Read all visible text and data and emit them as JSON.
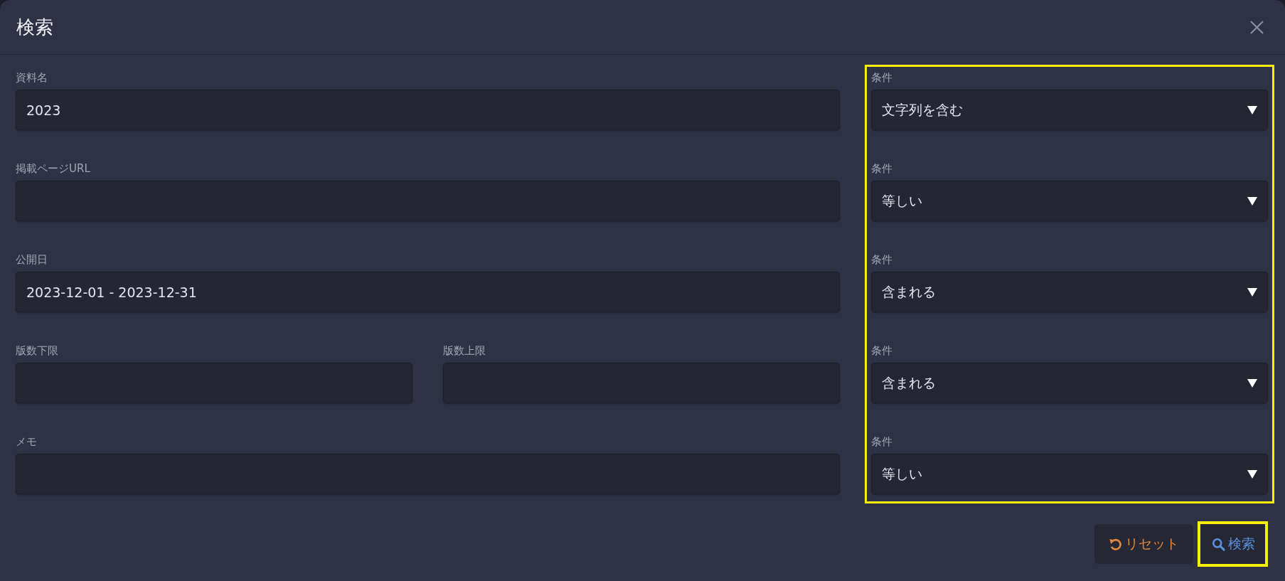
{
  "dialog": {
    "title": "検索"
  },
  "rows": [
    {
      "fields": [
        {
          "label": "資料名",
          "value": "2023"
        }
      ]
    },
    {
      "fields": [
        {
          "label": "掲載ページURL"
        }
      ]
    },
    {
      "fields": [
        {
          "label": "公開日",
          "value": "2023-12-01 - 2023-12-31"
        }
      ]
    },
    {
      "fields": [
        {
          "label": "版数下限"
        },
        {
          "label": "版数上限"
        }
      ]
    },
    {
      "fields": [
        {
          "label": "メモ"
        }
      ]
    }
  ],
  "conditions": {
    "highlighted": true,
    "items": [
      {
        "label": "条件",
        "value": "文字列を含む"
      },
      {
        "label": "条件",
        "value": "等しい"
      },
      {
        "label": "条件",
        "value": "含まれる"
      },
      {
        "label": "条件",
        "value": "含まれる"
      },
      {
        "label": "条件",
        "value": "等しい"
      }
    ]
  },
  "buttons": [
    {
      "kind": "reset",
      "label": "リセット",
      "highlighted": false
    },
    {
      "kind": "search",
      "label": "検索",
      "highlighted": true
    }
  ]
}
